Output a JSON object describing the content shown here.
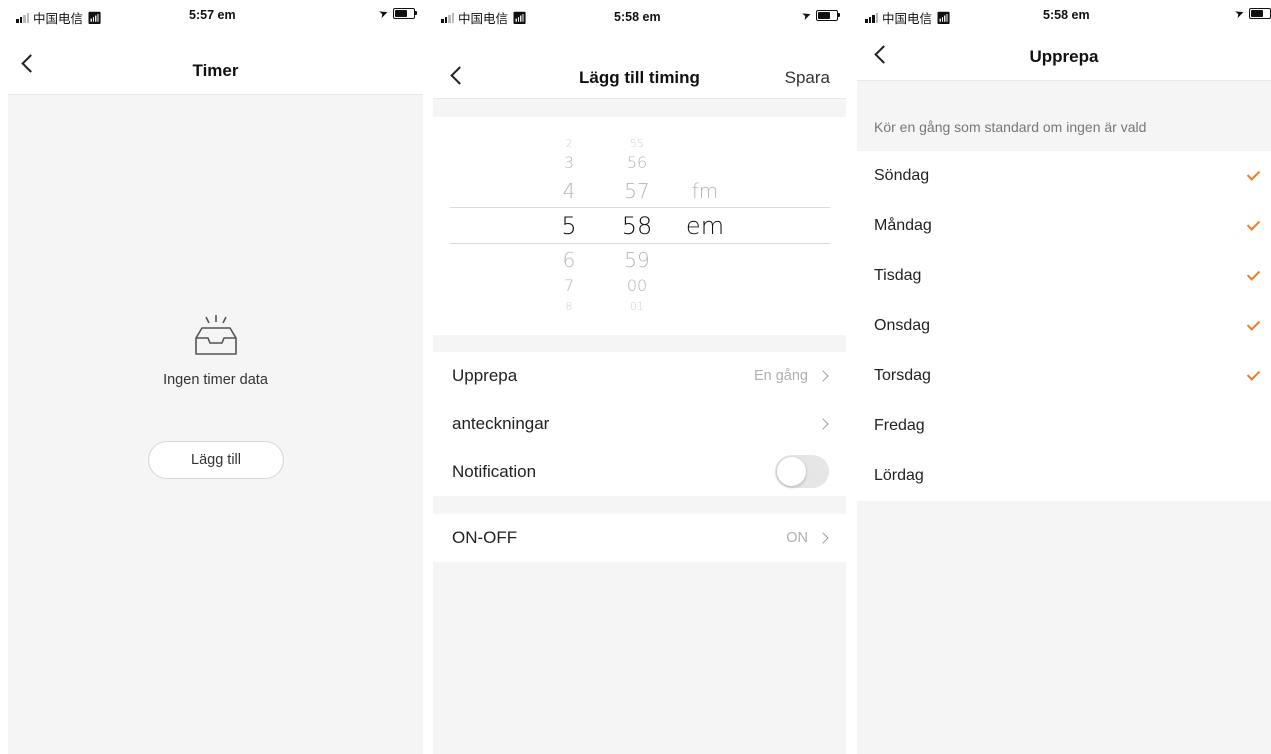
{
  "accent_color": "#ef7c27",
  "screen1": {
    "status": {
      "carrier": "中国电信",
      "time": "5:57 em"
    },
    "nav": {
      "title": "Timer"
    },
    "empty_text": "Ingen timer data",
    "add_button": "Lägg till"
  },
  "screen2": {
    "status": {
      "carrier": "中国电信",
      "time": "5:58 em"
    },
    "nav": {
      "title": "Lägg till timing",
      "save": "Spara"
    },
    "picker": {
      "hours": [
        "2",
        "3",
        "4",
        "5",
        "6",
        "7",
        "8"
      ],
      "minutes": [
        "55",
        "56",
        "57",
        "58",
        "59",
        "00",
        "01"
      ],
      "ampm": [
        "fm",
        "em"
      ],
      "selected": {
        "hour": "5",
        "minute": "58",
        "ampm": "em"
      }
    },
    "rows": {
      "repeat": {
        "label": "Upprepa",
        "value": "En gång"
      },
      "notes": {
        "label": "anteckningar"
      },
      "notification": {
        "label": "Notification",
        "enabled": false
      },
      "onoff": {
        "label": "ON-OFF",
        "value": "ON"
      }
    }
  },
  "screen3": {
    "status": {
      "carrier": "中国电信",
      "time": "5:58 em"
    },
    "nav": {
      "title": "Upprepa"
    },
    "hint": "Kör en gång som standard om ingen är vald",
    "days": [
      {
        "label": "Söndag",
        "checked": true
      },
      {
        "label": "Måndag",
        "checked": true
      },
      {
        "label": "Tisdag",
        "checked": true
      },
      {
        "label": "Onsdag",
        "checked": true
      },
      {
        "label": "Torsdag",
        "checked": true
      },
      {
        "label": "Fredag",
        "checked": false
      },
      {
        "label": "Lördag",
        "checked": false
      }
    ]
  }
}
